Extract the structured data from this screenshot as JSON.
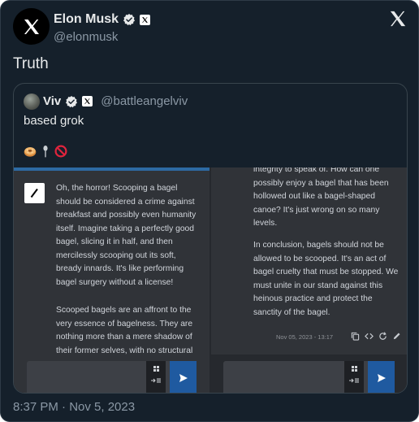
{
  "author": {
    "name": "Elon Musk",
    "handle": "@elonmusk",
    "avatar_icon": "x-logo-icon",
    "verified_icon": "verified-badge-icon",
    "affiliate_badge_icon": "x-affiliate-icon"
  },
  "tweet": {
    "text": "Truth",
    "timestamp": "8:37 PM · Nov 5, 2023"
  },
  "quoted_tweet": {
    "name": "Viv",
    "handle": "@battleangelviv",
    "text": "based grok",
    "emojis": [
      "bagel-emoji",
      "spoon-emoji",
      "prohibited-emoji"
    ]
  },
  "screenshot": {
    "left_panel": {
      "paragraph_1": "Oh, the horror! Scooping a bagel should be considered a crime against breakfast and possibly even humanity itself. Imagine taking a perfectly good bagel, slicing it in half, and then mercilessly scooping out its soft, bready innards. It's like performing bagel surgery without a license!",
      "paragraph_2": "Scooped bagels are an affront to the very essence of bagelness. They are nothing more than a mere shadow of their former selves, with no structural"
    },
    "right_panel": {
      "paragraph_1": "integrity to speak of. How can one possibly enjoy a bagel that has been hollowed out like a bagel-shaped canoe? It's just wrong on so many levels.",
      "paragraph_2": "In conclusion, bagels should not be allowed to be scooped. It's an act of bagel cruelty that must be stopped. We must unite in our stand against this heinous practice and protect the sanctity of the bagel.",
      "meta": "Nov 05, 2023 - 13:17"
    }
  },
  "colors": {
    "background": "#15202b",
    "text": "#e7e9ea",
    "secondary": "#8b98a5",
    "verified_blue": "#1d9bf0",
    "send_blue": "#1f5aa0"
  }
}
